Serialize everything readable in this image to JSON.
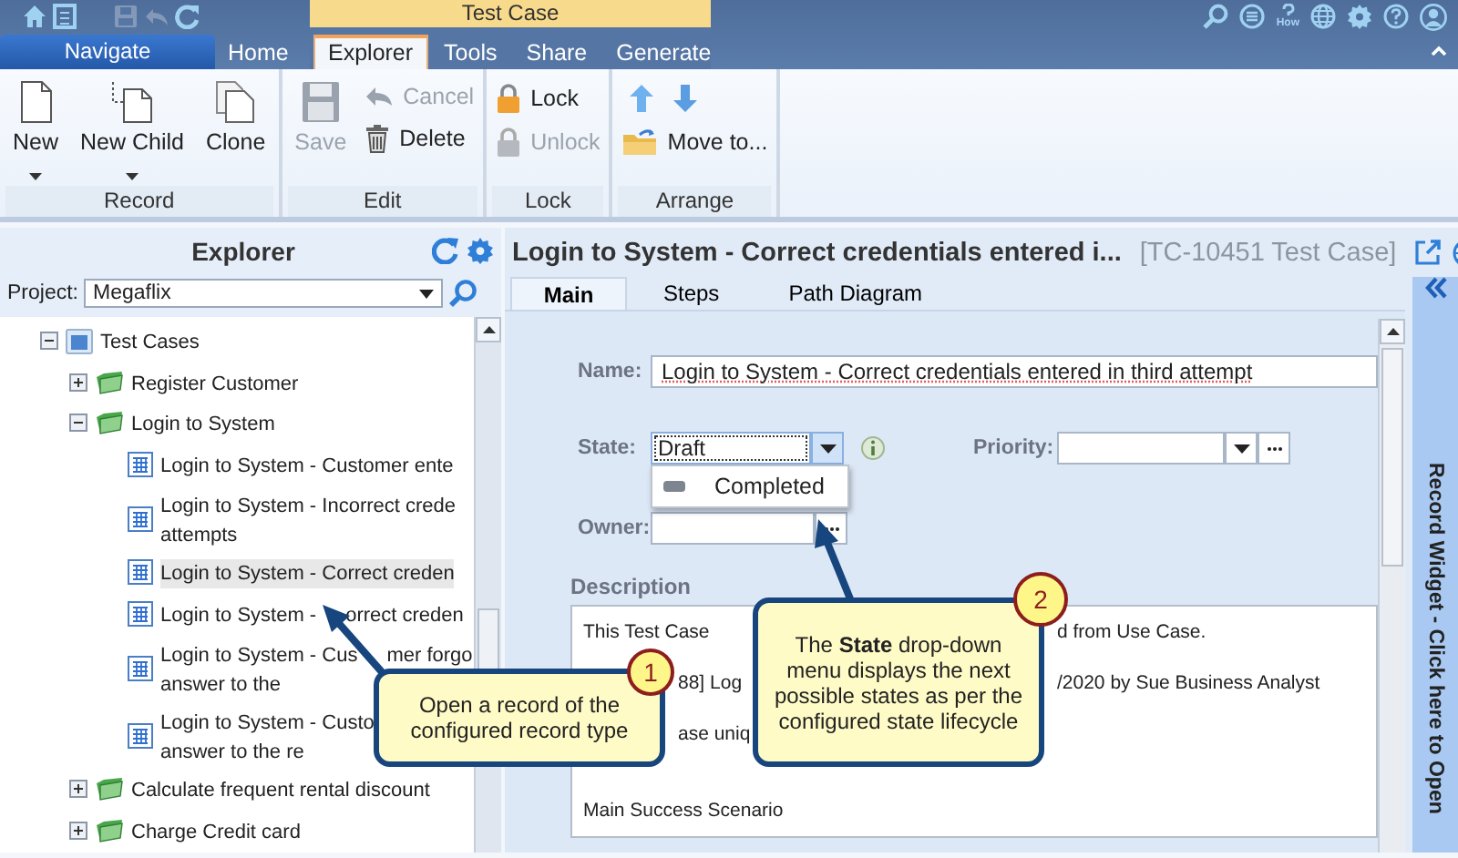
{
  "quick_actions": [
    {
      "disabled": false
    },
    {
      "disabled": false
    },
    {
      "disabled": true
    },
    {
      "disabled": true
    },
    {
      "disabled": false
    }
  ],
  "navigate_tab": {
    "label": "Navigate"
  },
  "context_label": "Test Case",
  "tabs": [
    {
      "label": "Home",
      "selected": false,
      "contextual": false
    },
    {
      "label": "Explorer",
      "selected": true,
      "contextual": true
    },
    {
      "label": "Tools",
      "selected": false,
      "contextual": true
    },
    {
      "label": "Share",
      "selected": false,
      "contextual": true
    },
    {
      "label": "Generate",
      "selected": false,
      "contextual": true
    }
  ],
  "header_icons": {
    "how_caption": "How"
  },
  "ribbon_groups": [
    {
      "label": "Record",
      "items": [
        {
          "kind": "large",
          "label": "New",
          "dropdown": true,
          "disabled": false
        },
        {
          "kind": "large",
          "label": "New Child",
          "dropdown": true,
          "disabled": false
        },
        {
          "kind": "large",
          "label": "Clone",
          "dropdown": false,
          "disabled": false
        }
      ]
    },
    {
      "label": "Edit",
      "items": [
        {
          "kind": "large",
          "label": "Save",
          "dropdown": false,
          "disabled": true
        },
        {
          "kind": "small",
          "label": "Cancel",
          "disabled": true
        },
        {
          "kind": "small",
          "label": "Delete",
          "disabled": false
        }
      ]
    },
    {
      "label": "Lock",
      "items": [
        {
          "kind": "small",
          "label": "Lock",
          "disabled": false
        },
        {
          "kind": "small",
          "label": "Unlock",
          "disabled": true
        }
      ]
    },
    {
      "label": "Arrange",
      "items": [
        {
          "kind": "icon",
          "disabled": false
        },
        {
          "kind": "icon",
          "disabled": false
        },
        {
          "kind": "small",
          "label": "Move to...",
          "disabled": false
        }
      ]
    }
  ],
  "explorer": {
    "title": "Explorer",
    "project_label": "Project:",
    "project": "Megaflix",
    "tree": [
      {
        "kind": "folder",
        "lines": [
          [
            "Test Cases"
          ]
        ],
        "expanded": true,
        "selected": false,
        "children": [
          {
            "kind": "group",
            "lines": [
              [
                "Register Customer"
              ]
            ],
            "expanded": false,
            "selected": false
          },
          {
            "kind": "group",
            "lines": [
              [
                "Login to System"
              ]
            ],
            "expanded": true,
            "selected": false,
            "children": [
              {
                "kind": "case",
                "lines": [
                  [
                    "Login to System - Customer ente"
                  ]
                ],
                "selected": false
              },
              {
                "kind": "case",
                "lines": [
                  [
                    "Login to System - Incorrect crede"
                  ],
                  [
                    "attempts"
                  ]
                ],
                "selected": false
              },
              {
                "kind": "case",
                "lines": [
                  [
                    "Login to System - Correct creden"
                  ]
                ],
                "selected": true
              },
              {
                "kind": "case",
                "lines": [
                  [
                    "Login to System -",
                    "orrect creden"
                  ]
                ],
                "selected": false
              },
              {
                "kind": "case",
                "lines": [
                  [
                    "Login to System - Cus",
                    "mer forgo"
                  ],
                  [
                    "answer to the"
                  ]
                ],
                "selected": false
              },
              {
                "kind": "case",
                "lines": [
                  [
                    "Login to System - Custo"
                  ],
                  [
                    "answer to the re"
                  ]
                ],
                "selected": false
              }
            ]
          },
          {
            "kind": "group",
            "lines": [
              [
                "Calculate frequent rental discount"
              ]
            ],
            "expanded": false,
            "selected": false
          },
          {
            "kind": "group",
            "lines": [
              [
                "Charge Credit card"
              ]
            ],
            "expanded": false,
            "selected": false
          }
        ]
      }
    ]
  },
  "record": {
    "title": "Login to System - Correct credentials entered i...",
    "id": "[TC-10451 Test Case]",
    "tabs": [
      {
        "label": "Main",
        "selected": true
      },
      {
        "label": "Steps",
        "selected": false
      },
      {
        "label": "Path Diagram",
        "selected": false
      }
    ],
    "name_label": "Name:",
    "name_value": "Login to System - Correct credentials entered in third attempt",
    "state_label": "State:",
    "state_value": "Draft",
    "state_expanded": true,
    "state_options": [
      {
        "label": "Completed",
        "selected": false
      }
    ],
    "priority_label": "Priority:",
    "owner_label": "Owner:",
    "description_label": "Description",
    "description_lines": [
      {
        "start": "This Test Case",
        "end": "d from Use Case."
      },
      {
        "middle": "88] Log",
        "end": "/2020 by Sue Business Analyst"
      },
      {
        "middle": "ase uniq"
      },
      {
        "start": "Main Success Scenario"
      }
    ]
  },
  "record_widget": "Record Widget - Click here to Open",
  "callouts": [
    {
      "number": "1",
      "text": "Open a record of the configured record type"
    },
    {
      "number": "2",
      "text": "The **State** drop-down menu displays the next possible states as per the configured state lifecycle"
    }
  ]
}
